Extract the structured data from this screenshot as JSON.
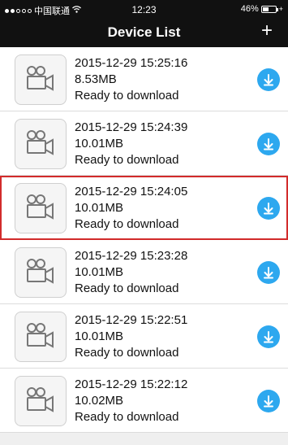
{
  "status_bar": {
    "carrier": "中国联通",
    "time": "12:23",
    "battery": "46%"
  },
  "header": {
    "title": "Device List",
    "add_label": "+"
  },
  "colors": {
    "header_bg": "#111111",
    "accent": "#2da8ef",
    "selected_border": "#d22b2b"
  },
  "icons": {
    "thumbnail": "video-camera-icon",
    "download": "download-arrow-icon"
  },
  "items": [
    {
      "datetime": "2015-12-29  15:25:16",
      "size": "8.53MB",
      "status": "Ready to download",
      "selected": false
    },
    {
      "datetime": "2015-12-29  15:24:39",
      "size": "10.01MB",
      "status": "Ready to download",
      "selected": false
    },
    {
      "datetime": "2015-12-29  15:24:05",
      "size": "10.01MB",
      "status": "Ready to download",
      "selected": true
    },
    {
      "datetime": "2015-12-29  15:23:28",
      "size": "10.01MB",
      "status": "Ready to download",
      "selected": false
    },
    {
      "datetime": "2015-12-29  15:22:51",
      "size": "10.01MB",
      "status": "Ready to download",
      "selected": false
    },
    {
      "datetime": "2015-12-29  15:22:12",
      "size": "10.02MB",
      "status": "Ready to download",
      "selected": false
    }
  ]
}
